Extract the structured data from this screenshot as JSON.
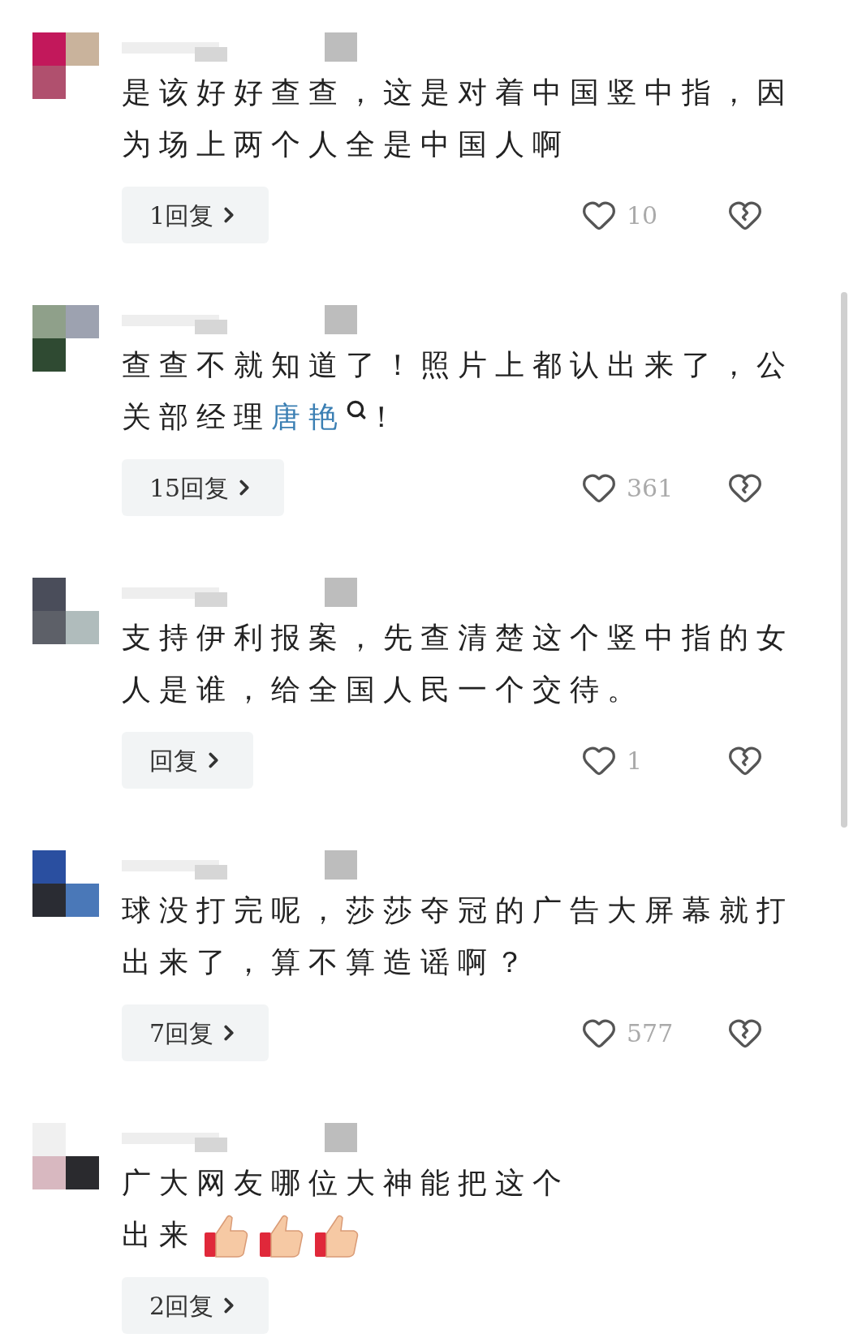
{
  "comments": [
    {
      "text": "是该好好查查，这是对着中国竖中指，因为场上两个人全是中国人啊",
      "replies": "1回复",
      "likes": "10"
    },
    {
      "text": "查查不就知道了！照片上都认出来了，公关部经理",
      "link": "唐艳",
      "text_after": "！",
      "replies": "15回复",
      "likes": "361"
    },
    {
      "text": "支持伊利报案，先查清楚这个竖中指的女人是谁，给全国人民一个交待。",
      "replies": "回复",
      "likes": "1"
    },
    {
      "text": "球没打完呢，莎莎夺冠的广告大屏幕就打出来了，算不算造谣啊？",
      "replies": "7回复",
      "likes": "577"
    },
    {
      "text": "广大网友哪位大神能把这个",
      "text_line2": "出来",
      "replies": "2回复"
    }
  ]
}
